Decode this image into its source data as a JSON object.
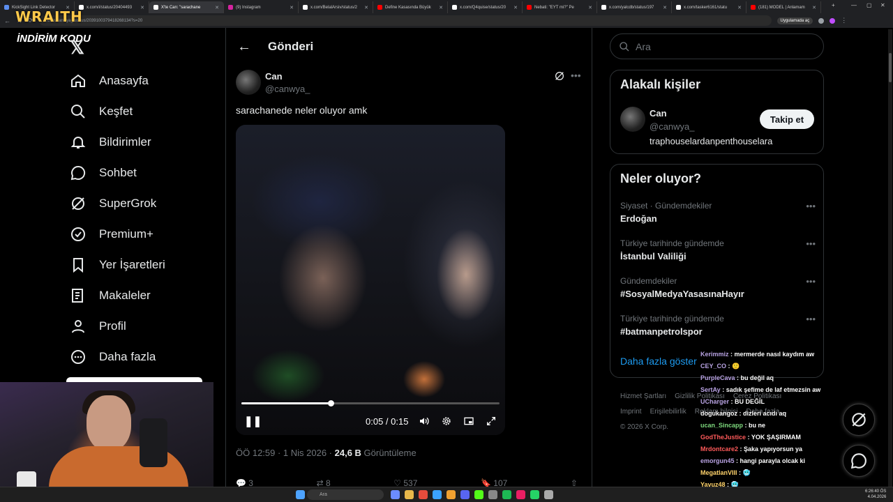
{
  "browser": {
    "tabs": [
      {
        "label": "KickSight Link Detector",
        "color": "#5b8def"
      },
      {
        "label": "x.com/i/status/20404493",
        "color": "#ffffff"
      },
      {
        "label": "X'te Can: \"sarachane",
        "color": "#ffffff",
        "active": true
      },
      {
        "label": "(9) Instagram",
        "color": "#d6249f"
      },
      {
        "label": "x.com/BelalArsiv/status/2",
        "color": "#ffffff"
      },
      {
        "label": "Define Kasasında Büyük",
        "color": "#ff0000"
      },
      {
        "label": "x.com/Q4quise/status/20",
        "color": "#ffffff"
      },
      {
        "label": "Nebati: \"EYT mi?\" Pe",
        "color": "#ff0000"
      },
      {
        "label": "x.com/yalcdb/status/197",
        "color": "#ffffff"
      },
      {
        "label": "x.com/tasker6161/statu",
        "color": "#ffffff"
      },
      {
        "label": "(181) MODEL | Anlamam",
        "color": "#ff0000"
      }
    ],
    "url": "x.com/canwya_/status/2039100379418268134?s=20",
    "app_pill": "Uygulamada aç"
  },
  "overlay": {
    "brand": "WRAITH",
    "promo": "İNDİRİM KODU"
  },
  "x_logo": "𝕏",
  "sidebar": {
    "items": [
      {
        "label": "Anasayfa",
        "icon": "home-icon"
      },
      {
        "label": "Keşfet",
        "icon": "search-icon"
      },
      {
        "label": "Bildirimler",
        "icon": "bell-icon"
      },
      {
        "label": "Sohbet",
        "icon": "chat-icon"
      },
      {
        "label": "SuperGrok",
        "icon": "grok-icon"
      },
      {
        "label": "Premium+",
        "icon": "verified-icon"
      },
      {
        "label": "Yer İşaretleri",
        "icon": "bookmark-icon"
      },
      {
        "label": "Makaleler",
        "icon": "article-icon"
      },
      {
        "label": "Profil",
        "icon": "profile-icon"
      },
      {
        "label": "Daha fazla",
        "icon": "more-circle-icon"
      }
    ]
  },
  "main": {
    "title": "Gönderi",
    "post": {
      "name": "Can",
      "handle": "@canwya_",
      "text": "sarachanede neler oluyor amk",
      "video": {
        "time": "0:05 / 0:15",
        "progress": 0.345,
        "hover": 0.56
      },
      "meta_time": "ÖÖ 12:59 · 1 Nis 2026 · ",
      "views": "24,6 B",
      "views_label": " Görüntüleme",
      "actions": {
        "replies": "3",
        "reposts": "8",
        "likes": "537",
        "bookmarks": "107"
      }
    }
  },
  "right": {
    "search_placeholder": "Ara",
    "related": {
      "title": "Alakalı kişiler",
      "name": "Can",
      "handle": "@canwya_",
      "bio": "traphouselardanpenthouselara",
      "follow": "Takip et"
    },
    "trends": {
      "title": "Neler oluyor?",
      "items": [
        {
          "category": "Siyaset · Gündemdekiler",
          "name": "Erdoğan"
        },
        {
          "category": "Türkiye tarihinde gündemde",
          "name": "İstanbul Valiliği"
        },
        {
          "category": "Gündemdekiler",
          "name": "#SosyalMedyaYasasınaHayır"
        },
        {
          "category": "Türkiye tarihinde gündemde",
          "name": "#batmanpetrolspor"
        }
      ],
      "show_more": "Daha fazla göster"
    },
    "footer": {
      "links": [
        "Hizmet Şartları",
        "Gizlilik Politikası",
        "Çerez Politikası",
        "Imprint",
        "Erişilebilirlik",
        "Reklam bilgisi",
        "Daha fazla ..."
      ],
      "copyright": "© 2026 X Corp."
    }
  },
  "chat": [
    {
      "user": "Kerimmiz",
      "color": "#b9a3e3",
      "msg": "mermerde nasıl kaydım aw"
    },
    {
      "user": "CEY_CO",
      "color": "#b9a3e3",
      "msg": "🙂"
    },
    {
      "user": "PurpleCava",
      "color": "#b9a3e3",
      "msg": "bu değil aq"
    },
    {
      "user": "SertAy",
      "color": "#b9a3e3",
      "msg": "sadık şefime de laf etmezsin aw"
    },
    {
      "user": "UCharger",
      "color": "#b9a3e3",
      "msg": "BU DEĞİL"
    },
    {
      "user": "dogukangoz",
      "color": "#ffffff",
      "msg": "dizleri acıdı aq"
    },
    {
      "user": "ucan_Sincapp",
      "color": "#7dd87d",
      "msg": "bu ne"
    },
    {
      "user": "GodTheJustice",
      "color": "#ff5a5a",
      "msg": "YOK ŞAŞIRMAM"
    },
    {
      "user": "Mrdontcare2",
      "color": "#ff5a5a",
      "msg": "Şaka yapıyorsun ya"
    },
    {
      "user": "emorgun45",
      "color": "#b9a3e3",
      "msg": "hangi parayla olcak ki"
    },
    {
      "user": "MegatlanVIII",
      "color": "#ffd36b",
      "msg": "🥶"
    },
    {
      "user": "Yavuz48",
      "color": "#ffd36b",
      "msg": "🥶"
    }
  ],
  "taskbar": {
    "search": "Ara",
    "time": "6:26:40 ÖS",
    "date": "4.04.2026"
  }
}
